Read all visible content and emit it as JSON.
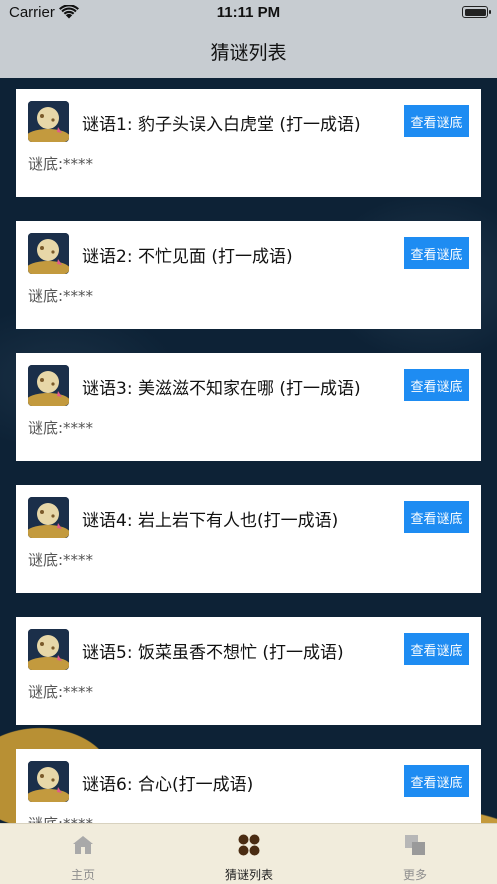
{
  "status_bar": {
    "carrier": "Carrier",
    "time": "11:11 PM"
  },
  "nav": {
    "title": "猜谜列表"
  },
  "riddles": [
    {
      "text": "谜语1: 豹子头误入白虎堂 (打一成语)",
      "button": "查看谜底",
      "answer": "谜底:****"
    },
    {
      "text": "谜语2: 不忙见面 (打一成语)",
      "button": "查看谜底",
      "answer": "谜底:****"
    },
    {
      "text": "谜语3: 美滋滋不知家在哪 (打一成语)",
      "button": "查看谜底",
      "answer": "谜底:****"
    },
    {
      "text": "谜语4: 岩上岩下有人也(打一成语)",
      "button": "查看谜底",
      "answer": "谜底:****"
    },
    {
      "text": "谜语5: 饭菜虽香不想忙 (打一成语)",
      "button": "查看谜底",
      "answer": "谜底:****"
    },
    {
      "text": "谜语6: 合心(打一成语)",
      "button": "查看谜底",
      "answer": "谜底:****"
    }
  ],
  "tabs": [
    {
      "label": "主页",
      "icon": "home-icon",
      "active": false
    },
    {
      "label": "猜谜列表",
      "icon": "grid-icon",
      "active": true
    },
    {
      "label": "更多",
      "icon": "more-icon",
      "active": false
    }
  ],
  "colors": {
    "button": "#1e8cf2",
    "nav_bg": "#c7ccd1",
    "background": "#0d2236",
    "tab_bar": "#f1ecdc"
  }
}
